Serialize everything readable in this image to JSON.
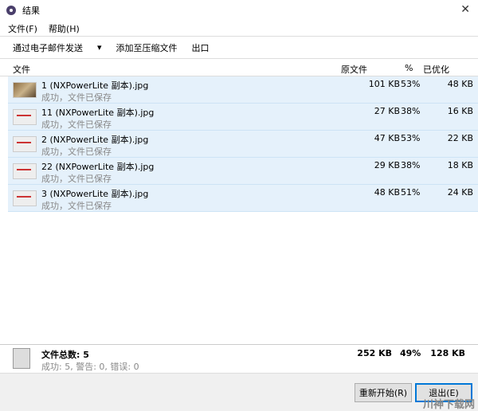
{
  "window": {
    "title": "结果",
    "close": "✕"
  },
  "menu": [
    "文件(F)",
    "帮助(H)"
  ],
  "toolbar": {
    "email": "通过电子邮件发送",
    "dropdown": "▾",
    "zip": "添加至压缩文件",
    "export": "出口"
  },
  "columns": {
    "file": "文件",
    "original": "原文件",
    "percent": "%",
    "optimized": "已优化"
  },
  "files": [
    {
      "name": "1 (NXPowerLite 副本).jpg",
      "status": "成功，文件已保存",
      "original": "101 KB",
      "percent": "53%",
      "optimized": "48 KB"
    },
    {
      "name": "11 (NXPowerLite 副本).jpg",
      "status": "成功，文件已保存",
      "original": "27 KB",
      "percent": "38%",
      "optimized": "16 KB"
    },
    {
      "name": "2 (NXPowerLite 副本).jpg",
      "status": "成功，文件已保存",
      "original": "47 KB",
      "percent": "53%",
      "optimized": "22 KB"
    },
    {
      "name": "22 (NXPowerLite 副本).jpg",
      "status": "成功，文件已保存",
      "original": "29 KB",
      "percent": "38%",
      "optimized": "18 KB"
    },
    {
      "name": "3 (NXPowerLite 副本).jpg",
      "status": "成功，文件已保存",
      "original": "48 KB",
      "percent": "51%",
      "optimized": "24 KB"
    }
  ],
  "summary": {
    "total": "文件总数: 5",
    "detail": "成功: 5, 警告: 0, 错误: 0",
    "original": "252 KB",
    "percent": "49%",
    "optimized": "128 KB"
  },
  "buttons": {
    "restart": "重新开始(R)",
    "exit": "退出(E)"
  },
  "watermark": "川神下载网",
  "colors": {
    "row_selected": "#e5f1fb",
    "default_button_border": "#0078d7"
  }
}
